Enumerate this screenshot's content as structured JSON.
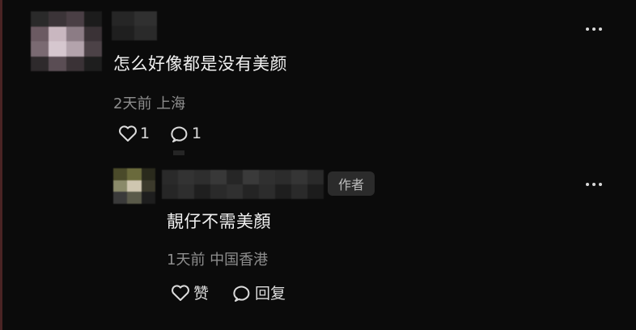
{
  "comment": {
    "text": "怎么好像都是没有美颜",
    "meta": "2天前 上海",
    "like_count": "1",
    "reply_count": "1",
    "avatar_pixels": [
      "#2a2a2a",
      "#3b3438",
      "#4a3f45",
      "#1c1c1c",
      "#6b5a62",
      "#c9b7c0",
      "#8c7c85",
      "#3a3236",
      "#7a6a72",
      "#d6c7cf",
      "#b3a3ac",
      "#4c4247",
      "#2e2a2c",
      "#5a4d54",
      "#3a3236",
      "#1e1e1e"
    ],
    "name_pixels": [
      "#262626",
      "#303030",
      "#1f1f1f",
      "#2a2a2a"
    ]
  },
  "reply": {
    "author_badge": "作者",
    "text": "靚仔不需美顏",
    "meta": "1天前 中国香港",
    "like_label": "赞",
    "reply_label": "回复",
    "avatar_pixels": [
      "#4a4a2a",
      "#6a6a3c",
      "#2a2a1c",
      "#8a8a6a",
      "#cfc6b0",
      "#3c3a2c",
      "#3a3a3a",
      "#5a5a4a",
      "#1e1e1e"
    ],
    "name_pixels": [
      "#2a2a2a",
      "#333333",
      "#2e2e2e",
      "#383838",
      "#262626",
      "#3a3a3a",
      "#303030",
      "#2c2c2c",
      "#353535",
      "#2a2a2a",
      "#262626",
      "#2e2e2e",
      "#1f1f1f",
      "#2a2a2a",
      "#303030",
      "#242424",
      "#2c2c2c",
      "#1e1e1e",
      "#2a2a2a",
      "#1c1c1c"
    ]
  }
}
